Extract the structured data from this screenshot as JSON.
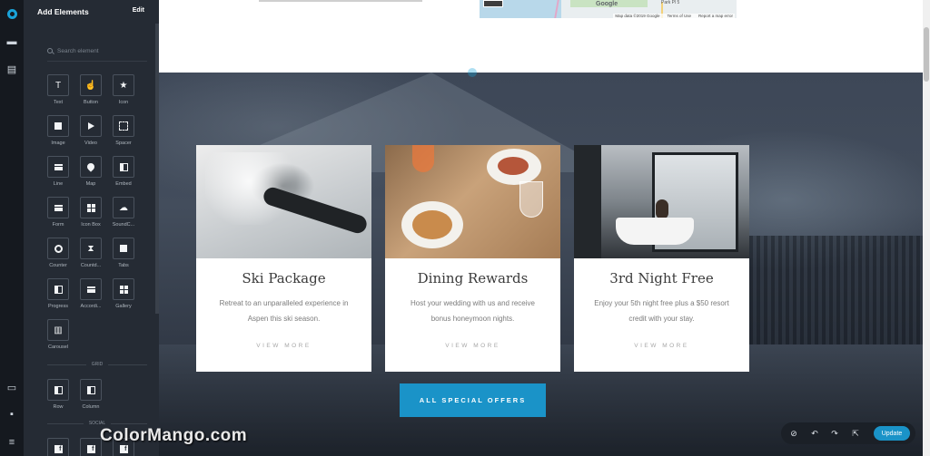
{
  "panel": {
    "title": "Add Elements",
    "edit_label": "Edit",
    "search_placeholder": "Search element",
    "elements": [
      {
        "label": "Text",
        "icon": "text-icon"
      },
      {
        "label": "Button",
        "icon": "pointer-icon"
      },
      {
        "label": "Icon",
        "icon": "star-icon"
      },
      {
        "label": "Image",
        "icon": "image-icon"
      },
      {
        "label": "Video",
        "icon": "play-icon"
      },
      {
        "label": "Spacer",
        "icon": "spacer-icon"
      },
      {
        "label": "Line",
        "icon": "line-icon"
      },
      {
        "label": "Map",
        "icon": "map-pin-icon"
      },
      {
        "label": "Embed",
        "icon": "embed-icon"
      },
      {
        "label": "Form",
        "icon": "form-icon"
      },
      {
        "label": "Icon Box",
        "icon": "icon-box-icon"
      },
      {
        "label": "SoundC...",
        "icon": "soundcloud-icon"
      },
      {
        "label": "Counter",
        "icon": "counter-icon"
      },
      {
        "label": "Countd...",
        "icon": "hourglass-icon"
      },
      {
        "label": "Tabs",
        "icon": "tabs-icon"
      },
      {
        "label": "Progress",
        "icon": "progress-icon"
      },
      {
        "label": "Accordi...",
        "icon": "accordion-icon"
      },
      {
        "label": "Gallery",
        "icon": "gallery-icon"
      },
      {
        "label": "Carousel",
        "icon": "carousel-icon"
      }
    ],
    "grid_section": "GRID",
    "grid_elements": [
      {
        "label": "Row",
        "icon": "row-icon"
      },
      {
        "label": "Column",
        "icon": "column-icon"
      }
    ],
    "social_section": "SOCIAL",
    "social_elements": [
      {
        "icon": "facebook-icon"
      },
      {
        "icon": "facebook-icon"
      },
      {
        "icon": "facebook-icon"
      }
    ]
  },
  "map": {
    "place_label": "Park Pl 5",
    "logo": "Google",
    "data_label": "Map data ©2019 Google",
    "terms_label": "Terms of Use",
    "report_label": "Report a map error"
  },
  "cards": [
    {
      "title": "Ski Package",
      "description": "Retreat to an unparalleled experience in Aspen this ski season.",
      "link": "VIEW MORE"
    },
    {
      "title": "Dining Rewards",
      "description": "Host your wedding with us and receive bonus honeymoon nights.",
      "link": "VIEW MORE"
    },
    {
      "title": "3rd Night Free",
      "description": "Enjoy your 5th night free plus a $50 resort credit with your stay.",
      "link": "VIEW MORE"
    }
  ],
  "cta_label": "ALL SPECIAL OFFERS",
  "watermark": "ColorMango.com",
  "toolbar": {
    "update_label": "Update"
  },
  "colors": {
    "accent": "#1a93c8",
    "panel": "#252b34",
    "rail": "#15191f"
  }
}
